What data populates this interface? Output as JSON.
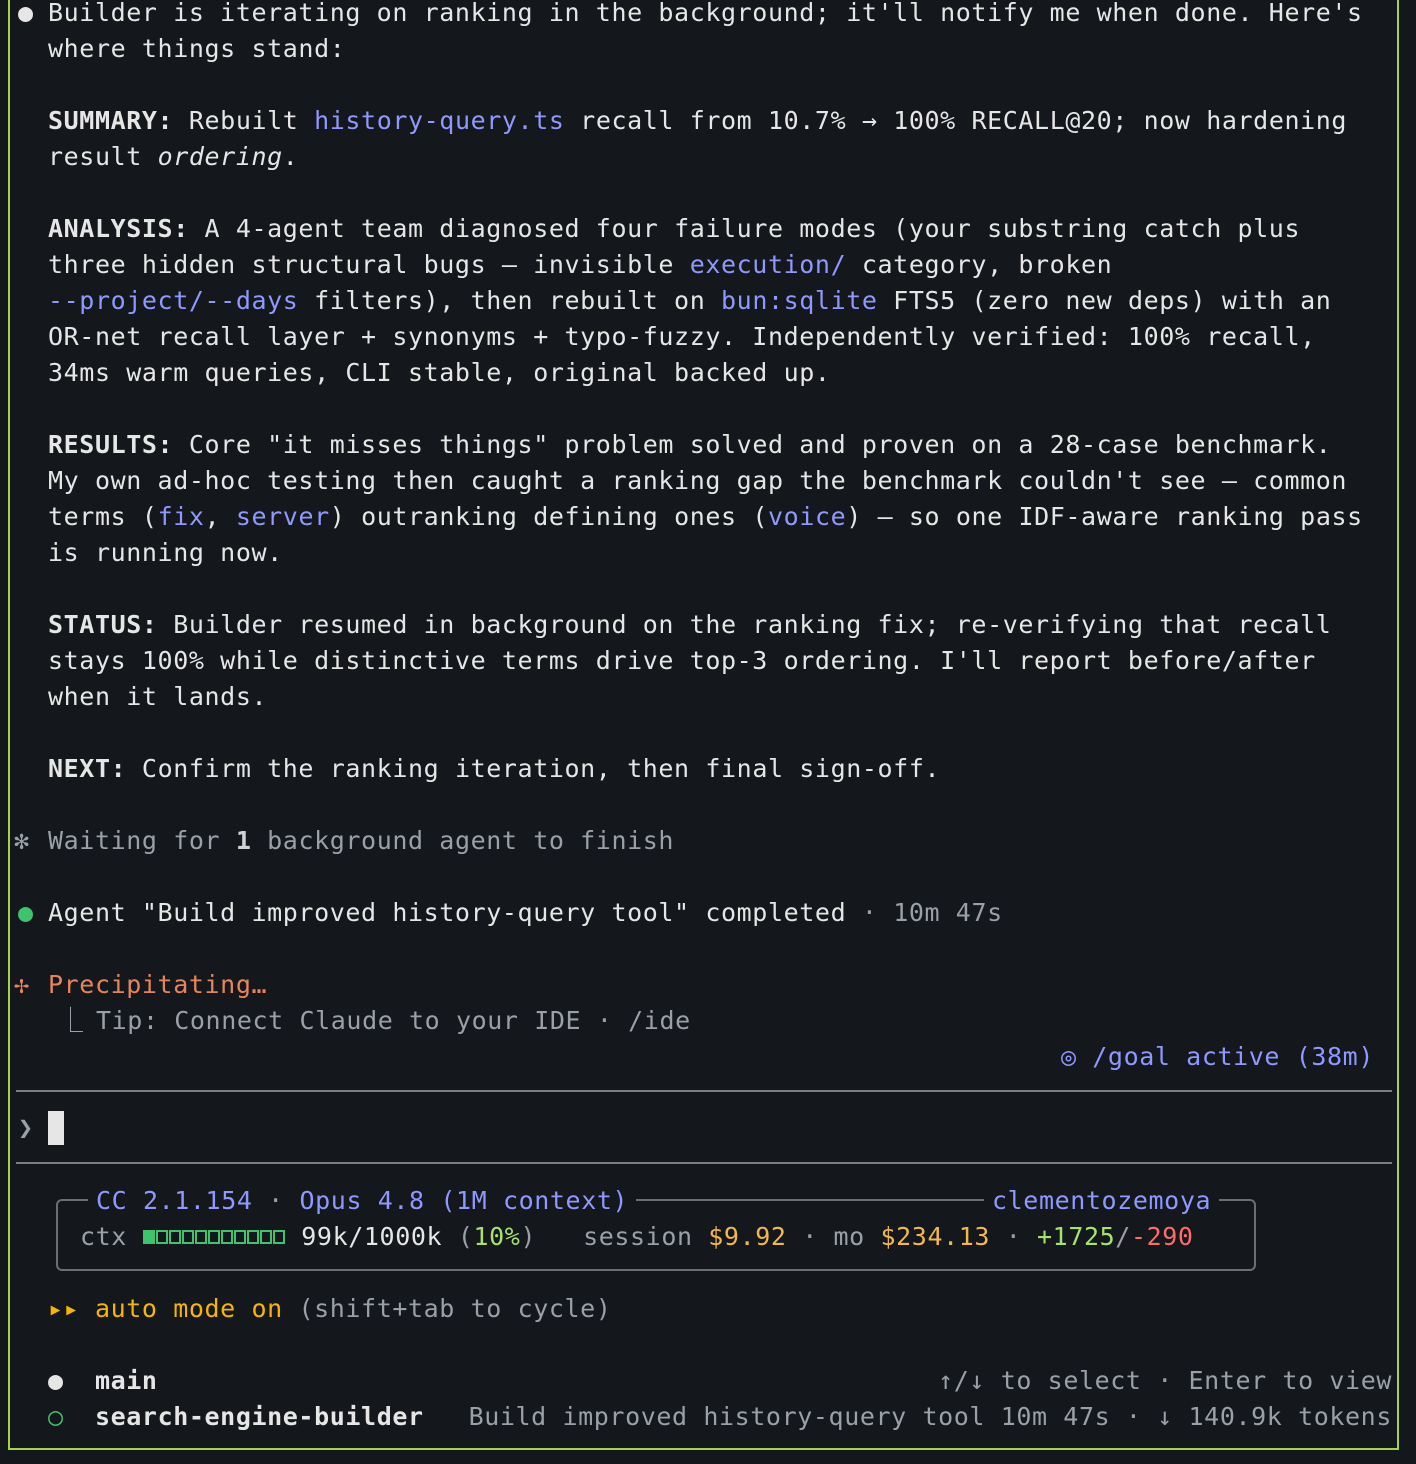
{
  "message": {
    "intro_l1": "Builder is iterating on ranking in the background; it'll notify me when done. Here's",
    "intro_l2": "where things stand:",
    "summary": {
      "label": "SUMMARY:",
      "t1": " Rebuilt ",
      "code1": "history-query.ts",
      "t2": " recall from 10.7% → 100% RECALL@20; now hardening",
      "t3": "result ",
      "em": "ordering",
      "t4": "."
    },
    "analysis": {
      "label": "ANALYSIS:",
      "l1": " A 4-agent team diagnosed four failure modes (your substring catch plus",
      "l2a": "three hidden structural bugs — invisible ",
      "code1": "execution/",
      "l2b": " category, broken",
      "code2": "--project/--days",
      "l3a": " filters), then rebuilt on ",
      "code3": "bun:sqlite",
      "l3b": " FTS5 (zero new deps) with an",
      "l4": "OR-net recall layer + synonyms + typo-fuzzy. Independently verified: 100% recall,",
      "l5": "34ms warm queries, CLI stable, original backed up."
    },
    "results": {
      "label": "RESULTS:",
      "l1": " Core \"it misses things\" problem solved and proven on a 28-case benchmark.",
      "l2": "My own ad-hoc testing then caught a ranking gap the benchmark couldn't see — common",
      "l3a": "terms (",
      "code1": "fix",
      "l3b": ", ",
      "code2": "server",
      "l3c": ") outranking defining ones (",
      "code3": "voice",
      "l3d": ") — so one IDF-aware ranking pass",
      "l4": "is running now."
    },
    "status": {
      "label": "STATUS:",
      "l1": " Builder resumed in background on the ranking fix; re-verifying that recall",
      "l2": "stays 100% while distinctive terms drive top-3 ordering. I'll report before/after",
      "l3": "when it lands."
    },
    "next": {
      "label": "NEXT:",
      "text": " Confirm the ranking iteration, then final sign-off."
    }
  },
  "waiting": {
    "prefix": "Waiting for ",
    "count": "1",
    "suffix": " background agent to finish"
  },
  "agent_done": {
    "text": "Agent \"Build improved history-query tool\" completed",
    "sep": " · ",
    "time": "10m 47s"
  },
  "activity": {
    "label": "Precipitating…",
    "tip": "Tip: Connect Claude to your IDE · /ide"
  },
  "goal": {
    "icon": "◎",
    "text": "/goal active (38m)"
  },
  "prompt": {
    "symbol": "❯"
  },
  "statusbar": {
    "cc": "CC 2.1.154",
    "sep": " · ",
    "model": "Opus 4.8 (1M context)",
    "user": "clementozemoya",
    "ctx_label": "ctx",
    "ctx_fraction": 0.1,
    "ctx_value": "99k/1000k",
    "ctx_pct_open": "(",
    "ctx_pct": "10%",
    "ctx_pct_close": ")",
    "session_label": "session",
    "session_value": "$9.92",
    "mo_label": "mo",
    "mo_value": "$234.13",
    "added": "+1725",
    "slash": "/",
    "removed": "-290"
  },
  "mode": {
    "arrows": "▸▸",
    "label": "auto mode on",
    "hint": " (shift+tab to cycle)"
  },
  "agents": {
    "hint": "↑/↓ to select · Enter to view",
    "main": {
      "bullet": "●",
      "name": "main"
    },
    "builder": {
      "bullet": "○",
      "name": "search-engine-builder",
      "desc": "Build improved history-query tool 10m 47s · ↓ 140.9k tokens"
    }
  },
  "colors": {
    "frame": "#a7d34a",
    "link": "#8f98ff",
    "accent": "#e8845b",
    "success": "#3ec46d",
    "cost": "#f2b84b"
  }
}
